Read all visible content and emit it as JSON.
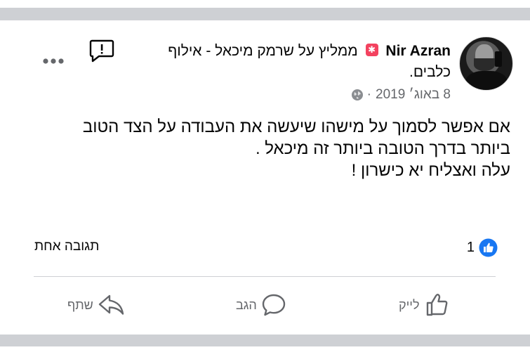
{
  "post": {
    "author": "Nir Azran",
    "recommendation_text": "ממליץ על שרמק מיכאל - אילוף כלבים.",
    "date": "8 באוג׳ 2019",
    "separator": "·",
    "body_lines": [
      "אם אפשר לסמוך על מישהו שיעשה את העבודה על הצד הטוב",
      "ביותר בדרך הטובה ביותר זה מיכאל .",
      "עלה ואצליח יא כישרון !"
    ],
    "reactions_count": "1",
    "comments_count": "תגובה אחת"
  },
  "actions": {
    "like_label": "לייק",
    "comment_label": "הגב",
    "share_label": "שתף"
  },
  "colors": {
    "badge": "#f3425f",
    "like_blue": "#1877f2",
    "secondary_text": "#65676b",
    "separator_bar": "#ced0d4"
  },
  "icons": {
    "report": "report-icon",
    "more": "more-options-icon",
    "badge": "recommendation-badge-icon",
    "privacy": "globe-icon",
    "like_reaction": "like-reaction-icon",
    "like": "thumbs-up-icon",
    "comment": "comment-bubble-icon",
    "share": "share-arrow-icon"
  }
}
